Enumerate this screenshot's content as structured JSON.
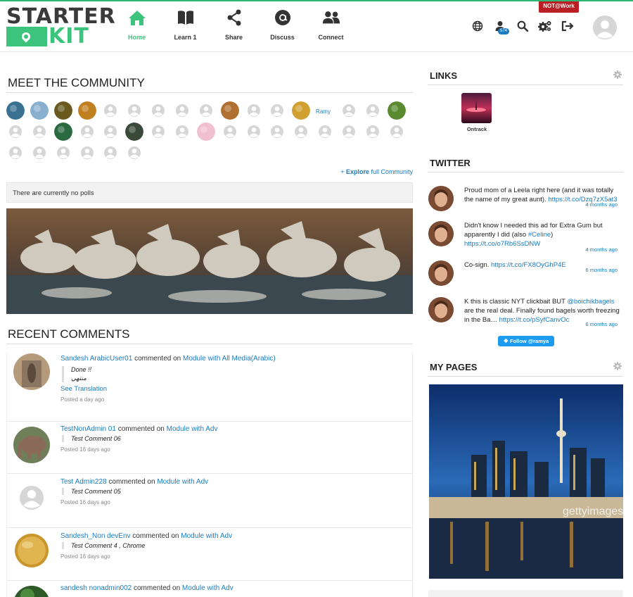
{
  "header": {
    "logo_top": "STARTER",
    "logo_bottom": "KIT",
    "nav": [
      {
        "label": "Home",
        "icon": "home-icon",
        "active": true
      },
      {
        "label": "Learn 1",
        "icon": "book-icon",
        "active": false
      },
      {
        "label": "Share",
        "icon": "share-icon",
        "active": false
      },
      {
        "label": "Discuss",
        "icon": "discuss-icon",
        "active": false
      },
      {
        "label": "Connect",
        "icon": "connect-icon",
        "active": false
      }
    ],
    "notification_count": "574",
    "org_badge": "NOT@Work"
  },
  "community": {
    "title": "MEET THE COMMUNITY",
    "broken_image_alt": "Ramy",
    "explore_prefix": "+ ",
    "explore_bold": "Explore",
    "explore_rest": " full Community"
  },
  "polls": {
    "text": "There are currently no polls"
  },
  "recent_comments": {
    "title": "RECENT COMMENTS",
    "items": [
      {
        "author": "Sandesh ArabicUser01",
        "verb": " commented on ",
        "target": "Module with All Media(Arabic)",
        "quote_lines": [
          "Done !!",
          "منتهي"
        ],
        "translation": "See Translation",
        "time": "Posted a day ago"
      },
      {
        "author": "TestNonAdmin 01",
        "verb": " commented on ",
        "target": "Module with Adv",
        "quote_lines": [
          "Test Comment 06"
        ],
        "translation": "",
        "time": "Posted 16 days ago"
      },
      {
        "author": "Test Admin228",
        "verb": " commented on ",
        "target": "Module with Adv",
        "quote_lines": [
          "Test Comment 05"
        ],
        "translation": "",
        "time": "Posted 16 days ago"
      },
      {
        "author": "Sandesh_Non devEnv",
        "verb": " commented on ",
        "target": "Module with Adv",
        "quote_lines": [
          "Test Comment 4 , Chrome"
        ],
        "translation": "",
        "time": "Posted 16 days ago"
      },
      {
        "author": "sandesh nonadmin002",
        "verb": " commented on ",
        "target": "Module with Adv",
        "quote_lines": [],
        "translation": "",
        "time": ""
      }
    ]
  },
  "links": {
    "title": "LINKS",
    "items": [
      {
        "label": "Ontrack"
      }
    ]
  },
  "twitter": {
    "title": "TWITTER",
    "tweets": [
      {
        "text": "Proud mom of a Leela right here (and it was totally the name of my great aunt). ",
        "link": "https://t.co/Dzq7zX5at3",
        "time": "4 months ago"
      },
      {
        "text": "Didn't know I needed this ad for Extra Gum but apparently I did (also ",
        "hashtag": "#Celine",
        "text2": ") ",
        "link": "https://t.co/o7Rb6SsDNW",
        "time": "4 months ago"
      },
      {
        "text": "Co-sign. ",
        "link": "https://t.co/FX8OyGhP4E",
        "time": "6 months ago"
      },
      {
        "text": "K this is classic NYT clickbait BUT ",
        "mention": "@boichikbagels",
        "text2": " are the real deal. Finally found bagels worth freezing in the Ba… ",
        "link": "https://t.co/pSyfCanvOc",
        "time": "6 months ago"
      }
    ],
    "follow_label": "Follow @ramya"
  },
  "my_pages": {
    "title": "MY PAGES",
    "image_watermark": "gettyimages"
  },
  "colors": {
    "accent": "#3cc47c",
    "link": "#1a7bbf",
    "badge_red": "#b91f24",
    "twitter": "#1d9bf0"
  }
}
